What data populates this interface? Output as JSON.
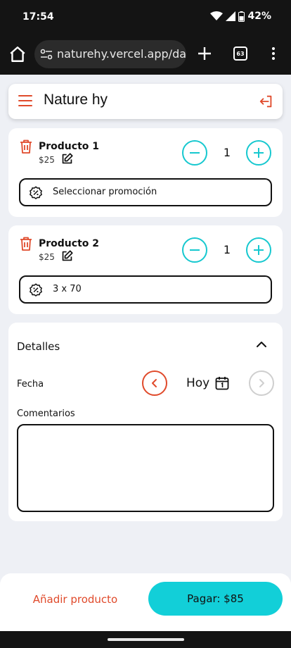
{
  "status_bar": {
    "time": "17:54",
    "battery": "42%"
  },
  "browser": {
    "url": "naturehy.vercel.app/dash",
    "tab_count": "63"
  },
  "header": {
    "title": "Nature hy"
  },
  "products": [
    {
      "name": "Producto 1",
      "price": "$25",
      "quantity": "1",
      "promo": "Seleccionar promoción"
    },
    {
      "name": "Producto 2",
      "price": "$25",
      "quantity": "1",
      "promo": "3 x 70"
    }
  ],
  "details": {
    "title": "Detalles",
    "date_label": "Fecha",
    "date_value": "Hoy",
    "comments_label": "Comentarios",
    "comments_value": ""
  },
  "footer": {
    "add_product_label": "Añadir producto",
    "pay_label": "Pagar: $85"
  },
  "colors": {
    "accent": "#16c8cf",
    "danger": "#e04a2b",
    "pay_bg": "#12cfd8"
  }
}
